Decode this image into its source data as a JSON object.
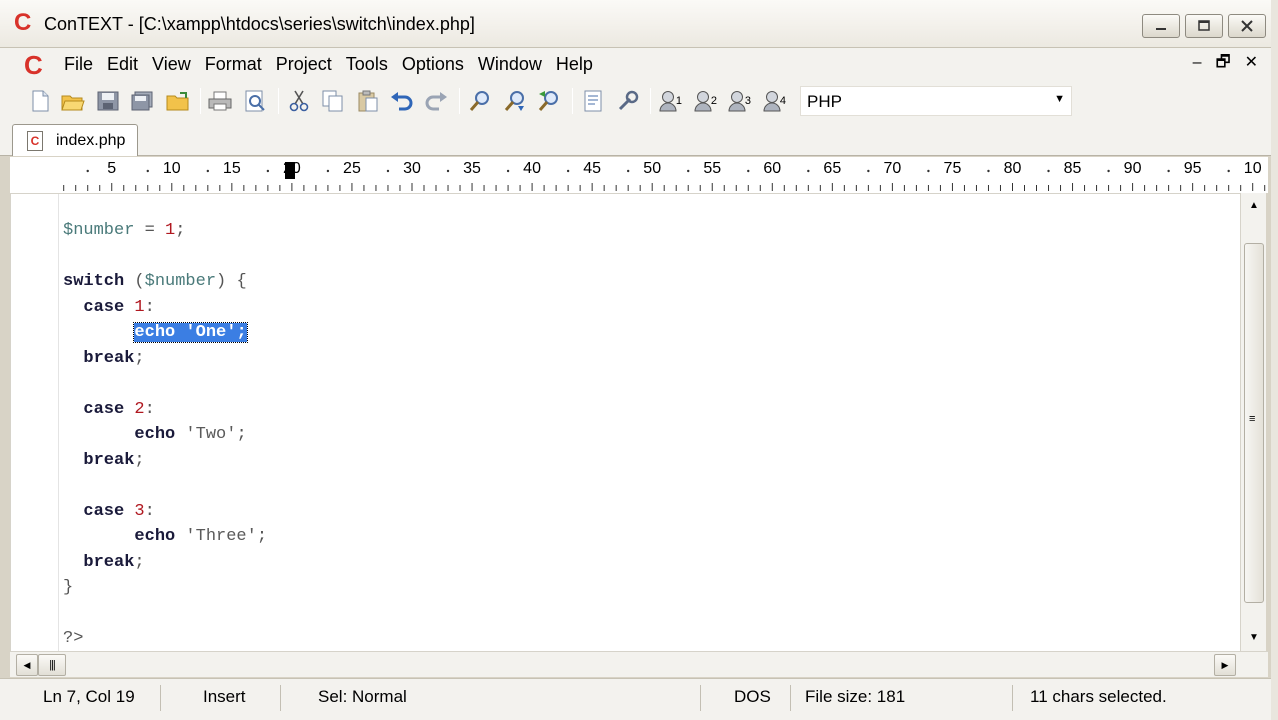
{
  "window": {
    "app_logo": "C",
    "title": "ConTEXT - [C:\\xampp\\htdocs\\series\\switch\\index.php]",
    "controls": [
      "minimize-icon",
      "maximize-icon",
      "close-icon"
    ]
  },
  "menubar": {
    "items": [
      "File",
      "Edit",
      "View",
      "Format",
      "Project",
      "Tools",
      "Options",
      "Window",
      "Help"
    ],
    "mdi_controls": [
      "–",
      "🗗",
      "✕"
    ]
  },
  "toolbar": {
    "buttons": [
      "new-file-icon",
      "open-file-icon",
      "save-icon",
      "save-all-icon",
      "open-folder-icon",
      "print-icon",
      "print-preview-icon",
      "cut-icon",
      "copy-icon",
      "paste-icon",
      "undo-icon",
      "redo-icon",
      "find-icon",
      "find-next-icon",
      "replace-icon",
      "export-icon",
      "settings-icon",
      "user-command-1-icon",
      "user-command-2-icon",
      "user-command-3-icon",
      "user-command-4-icon"
    ],
    "user_command_numbers": [
      "1",
      "2",
      "3",
      "4"
    ],
    "language": "PHP"
  },
  "tabs": [
    {
      "label": "index.php",
      "active": true
    }
  ],
  "ruler": {
    "labels": [
      "5",
      "10",
      "15",
      "20",
      "25",
      "30",
      "35",
      "40",
      "45",
      "50",
      "55",
      "60",
      "65",
      "70",
      "75",
      "80",
      "85",
      "90",
      "95",
      "10"
    ],
    "cursor_column": 19
  },
  "editor": {
    "lines": [
      "$number = 1;",
      "",
      "switch ($number) {",
      "  case 1:",
      "       echo 'One';",
      "  break;",
      "",
      "  case 2:",
      "       echo 'Two';",
      "  break;",
      "",
      "  case 3:",
      "       echo 'Three';",
      "  break;",
      "}",
      "",
      "?>"
    ],
    "selected_text": "echo 'One';"
  },
  "statusbar": {
    "position": "Ln 7, Col 19",
    "mode": "Insert",
    "selection_mode": "Sel: Normal",
    "line_ending": "DOS",
    "file_size": "File size: 181",
    "selection_info": "11 chars selected."
  },
  "colors": {
    "selection": "#3b7ee3",
    "logo": "#d8322a",
    "keyword": "#1a1a3a",
    "variable": "#4a7a7a",
    "number": "#b01820"
  }
}
